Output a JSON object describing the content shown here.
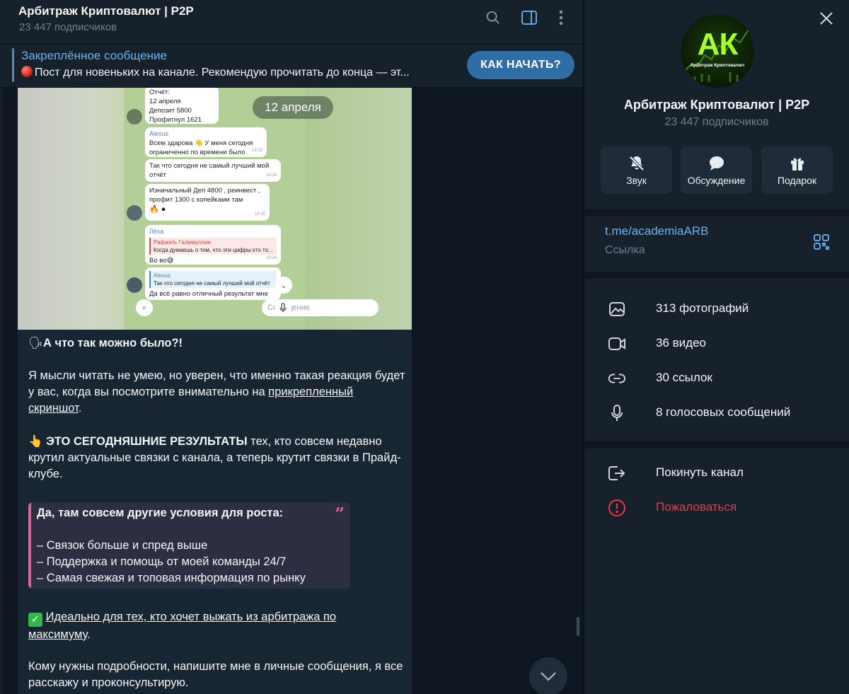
{
  "header": {
    "title": "Арбитраж Криптовалют | P2P",
    "subtitle": "23 447 подписчиков",
    "icons": [
      "search-icon",
      "sidebar-toggle-icon",
      "more-vertical-icon"
    ]
  },
  "pinned": {
    "title": "Закреплённое сообщение",
    "text": "Пост для новеньких на канале. Рекомендую прочитать до конца — эт...",
    "button_label": "КАК НАЧАТЬ?"
  },
  "photo": {
    "date_pill": "12 апреля",
    "report": [
      "Отчёт:",
      "12 апреля",
      "Депозит 5800",
      "Профитнул 1621"
    ],
    "msg1_name": "Alexus",
    "msg1_text": "Всем здарова 👋 У меня сегодня ограниченно по времени было",
    "msg1_time": "18:33",
    "msg2_text": "Так что сегодня не самый лучший мой отчёт",
    "msg2_time": "18:34",
    "msg3_text": "Изначальный Деп 4800 , реинвест , профит 1300 с копейками там",
    "msg3_time": "18:35",
    "msg4_name": "Лёха",
    "msg4_quote_name": "Рафаэль Галимуллин",
    "msg4_quote": "Когда думаешь о том, что эти цифры кто то...",
    "msg4_text": "Во во😅",
    "msg4_time": "18:36",
    "msg5_quote_name": "Alexus",
    "msg5_quote": "Так что сегодня не самый лучший мой отчёт",
    "msg5_text": "Да всё равно отличный результат мне",
    "compose_placeholder": "Сообщение"
  },
  "message": {
    "heading_emoji": "🗣",
    "heading": "А что так можно было?!",
    "p1_a": "Я мысли читать не умею, но уверен, что именно такая реакция будет у вас, когда вы посмотрите внимательно на ",
    "p1_link": "прикрепленный скриншот",
    "p1_b": ".",
    "p2_emoji": "👆",
    "p2_bold": "ЭТО СЕГОДНЯШНИЕ РЕЗУЛЬТАТЫ",
    "p2_rest": " тех, кто совсем недавно крутил актуальные связки с канала, а теперь крутит связки в Прайд-клубе.",
    "quote_title": "Да, там совсем другие условия для роста:",
    "quote_items": [
      "– Связок больше и спред выше",
      "– Поддержка и помощь от моей команды 24/7",
      "– Самая свежая и топовая информация по рынку"
    ],
    "p3_emoji": "✅",
    "p3_link_a": "Идеально для тех, кто хочет выжать из арбитража по",
    "p3_link_b": "максимуму",
    "p3_end": ".",
    "p4": "Кому нужны подробности, напишите мне в личные сообщения, я все расскажу и проконсультирую."
  },
  "profile": {
    "avatar_text": "АК",
    "avatar_subtext": "Арбитраж Криптовалют",
    "title": "Арбитраж Криптовалют | P2P",
    "subtitle": "23 447 подписчиков",
    "actions": [
      {
        "label": "Звук",
        "icon": "bell-muted-icon"
      },
      {
        "label": "Обсуждение",
        "icon": "chat-bubble-icon"
      },
      {
        "label": "Подарок",
        "icon": "gift-icon"
      }
    ],
    "link": "t.me/academiaARB",
    "link_label": "Ссылка",
    "media": [
      {
        "label": "313 фотографий",
        "icon": "photo-icon"
      },
      {
        "label": "36 видео",
        "icon": "video-icon"
      },
      {
        "label": "30 ссылок",
        "icon": "link-icon"
      },
      {
        "label": "8 голосовых сообщений",
        "icon": "microphone-icon"
      }
    ],
    "leave_label": "Покинуть канал",
    "report_label": "Пожаловаться"
  },
  "colors": {
    "accent": "#6ab3f3",
    "pin_button": "#2f6ea5",
    "danger": "#ec3942",
    "quote_accent": "#e0619a"
  }
}
